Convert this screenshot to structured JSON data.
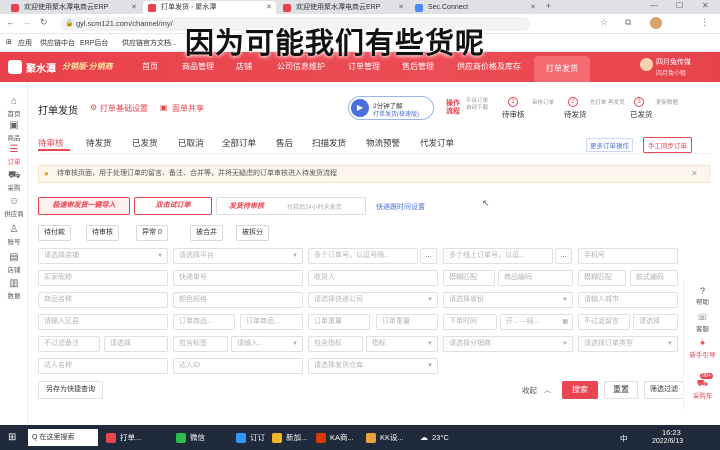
{
  "caption": "因为可能我们有些货呢",
  "browser": {
    "tabs": [
      {
        "label": "欢迎使用聚水潭电商云ERP",
        "active": false,
        "color": "#e9414c"
      },
      {
        "label": "打单发货 - 聚水潭",
        "active": true,
        "color": "#e9414c"
      },
      {
        "label": "欢迎使用聚水潭电商云ERP",
        "active": false,
        "color": "#e9414c"
      },
      {
        "label": "Sec.Connect",
        "active": false,
        "color": "#4a8af4"
      }
    ],
    "url": "gyl.scm121.com/channel/my/",
    "bookmarks": [
      "应用",
      "供应链中台",
      "ERP后台",
      "供应链官方文档..."
    ]
  },
  "header": {
    "brand": "聚水潭",
    "slogan": "分销版·分销商",
    "nav": [
      {
        "label": "首页",
        "active": false
      },
      {
        "label": "商品管理",
        "active": false
      },
      {
        "label": "店铺",
        "active": false
      },
      {
        "label": "公司信息维护",
        "active": false
      },
      {
        "label": "订单管理",
        "active": false
      },
      {
        "label": "售后管理",
        "active": false
      },
      {
        "label": "供应商价格及库存",
        "active": false
      },
      {
        "label": "打单发货",
        "active": true
      }
    ],
    "user_name": "四月兔传媒",
    "user_sub": "四月兔小租"
  },
  "sidebar": {
    "items": [
      {
        "label": "首页",
        "icon": "home-icon",
        "glyph": "⌂"
      },
      {
        "label": "商品",
        "icon": "goods-icon",
        "glyph": "▣"
      },
      {
        "label": "订单",
        "icon": "order-icon",
        "glyph": "☰",
        "active": true
      },
      {
        "label": "采购",
        "icon": "cart-icon",
        "glyph": "⛟"
      },
      {
        "label": "供应商",
        "icon": "supplier-icon",
        "glyph": "☺"
      },
      {
        "label": "账号",
        "icon": "account-icon",
        "glyph": "♙"
      },
      {
        "label": "店铺",
        "icon": "store-icon",
        "glyph": "▤"
      },
      {
        "label": "数据",
        "icon": "data-icon",
        "glyph": "▥"
      }
    ]
  },
  "page": {
    "title": "打单发货",
    "rules_link": "打单基础设置",
    "share_link": "面单共享",
    "video_label": "2分钟了解",
    "video_sub": "打单发货(极速版)",
    "flow_label": "操作流程",
    "flow_hint": "平台订单自动下载",
    "flow_steps": [
      {
        "num": "1",
        "label": "待审核",
        "sub": "审核订单"
      },
      {
        "num": "2",
        "label": "待发货",
        "sub": "先打单 再发货"
      },
      {
        "num": "3",
        "label": "已发货",
        "sub": "更新数据"
      }
    ],
    "more_ops": "更多订单操作",
    "manual_sync": "手工同步订单"
  },
  "tabs": [
    "待审核",
    "待发货",
    "已发货",
    "已取消",
    "全部订单",
    "售后",
    "扫描发货",
    "物流预警",
    "代发订单"
  ],
  "notice": "待审核页面，用于处理订单的留言、备注、合并等，并将无疑虑的订单审核进入待发货流程",
  "actions": {
    "audit_one": "极速审发货一键导入",
    "approve": "双击试订单",
    "ship": "发货待审核",
    "ship_hint": "付款后24小时未发货",
    "quick_setting": "快递跟时间设置"
  },
  "filters_top": [
    {
      "label": "待付款"
    },
    {
      "label": "待审核"
    },
    {
      "label": "异常 0"
    },
    {
      "label": "被合并"
    },
    {
      "label": "被拆分"
    }
  ],
  "fields": {
    "r1": [
      "请选择店铺",
      "请选择平台",
      "多个订单号，以逗号隔...",
      "多个线上订单号，以逗...",
      "手机号"
    ],
    "r2": [
      "买家昵称",
      "快递单号",
      "收货人",
      "模糊匹配",
      "商品编码",
      "模糊匹配",
      "款式编码"
    ],
    "r3": [
      "商品名称",
      "颜色规格",
      "请选择快递公司",
      "请选择省份",
      "请输入城市"
    ],
    "r4": [
      "请输入区县",
      "订单商品...",
      "订单商品...",
      "订单重量",
      "订单重量",
      "下单时间",
      "开...",
      "结...",
      "不过滤留言",
      "请选择"
    ],
    "r5": [
      "不过滤备注",
      "请选择",
      "包含标签",
      "请输入...",
      "包含指标",
      "指标",
      "请选择分销商",
      "请选择订单类型"
    ],
    "r6": [
      "达人名称",
      "达人ID",
      "请选择发货仓库"
    ]
  },
  "bottom": {
    "save_query": "另存为快捷查询",
    "collapse": "收起",
    "search": "搜索",
    "reset": "重置",
    "filter": "筛选过滤"
  },
  "right_bar": [
    {
      "label": "帮助",
      "icon": "help-icon"
    },
    {
      "label": "客服",
      "icon": "service-icon"
    },
    {
      "label": "新手引导",
      "icon": "guide-icon"
    },
    {
      "label": "采购车",
      "icon": "cart-icon",
      "badge": "99+"
    }
  ],
  "taskbar": {
    "items": [
      "Q 在这里搜索",
      "打单...",
      "微信",
      "订订",
      "新加...",
      "KA商...",
      "KK设..."
    ],
    "weather": "23°C",
    "ime": "中",
    "time": "16:23",
    "date": "2022/6/13"
  },
  "colors": {
    "accent": "#e94550",
    "brand_red": "#e9414c",
    "taskbar": "#1f2a3a"
  }
}
